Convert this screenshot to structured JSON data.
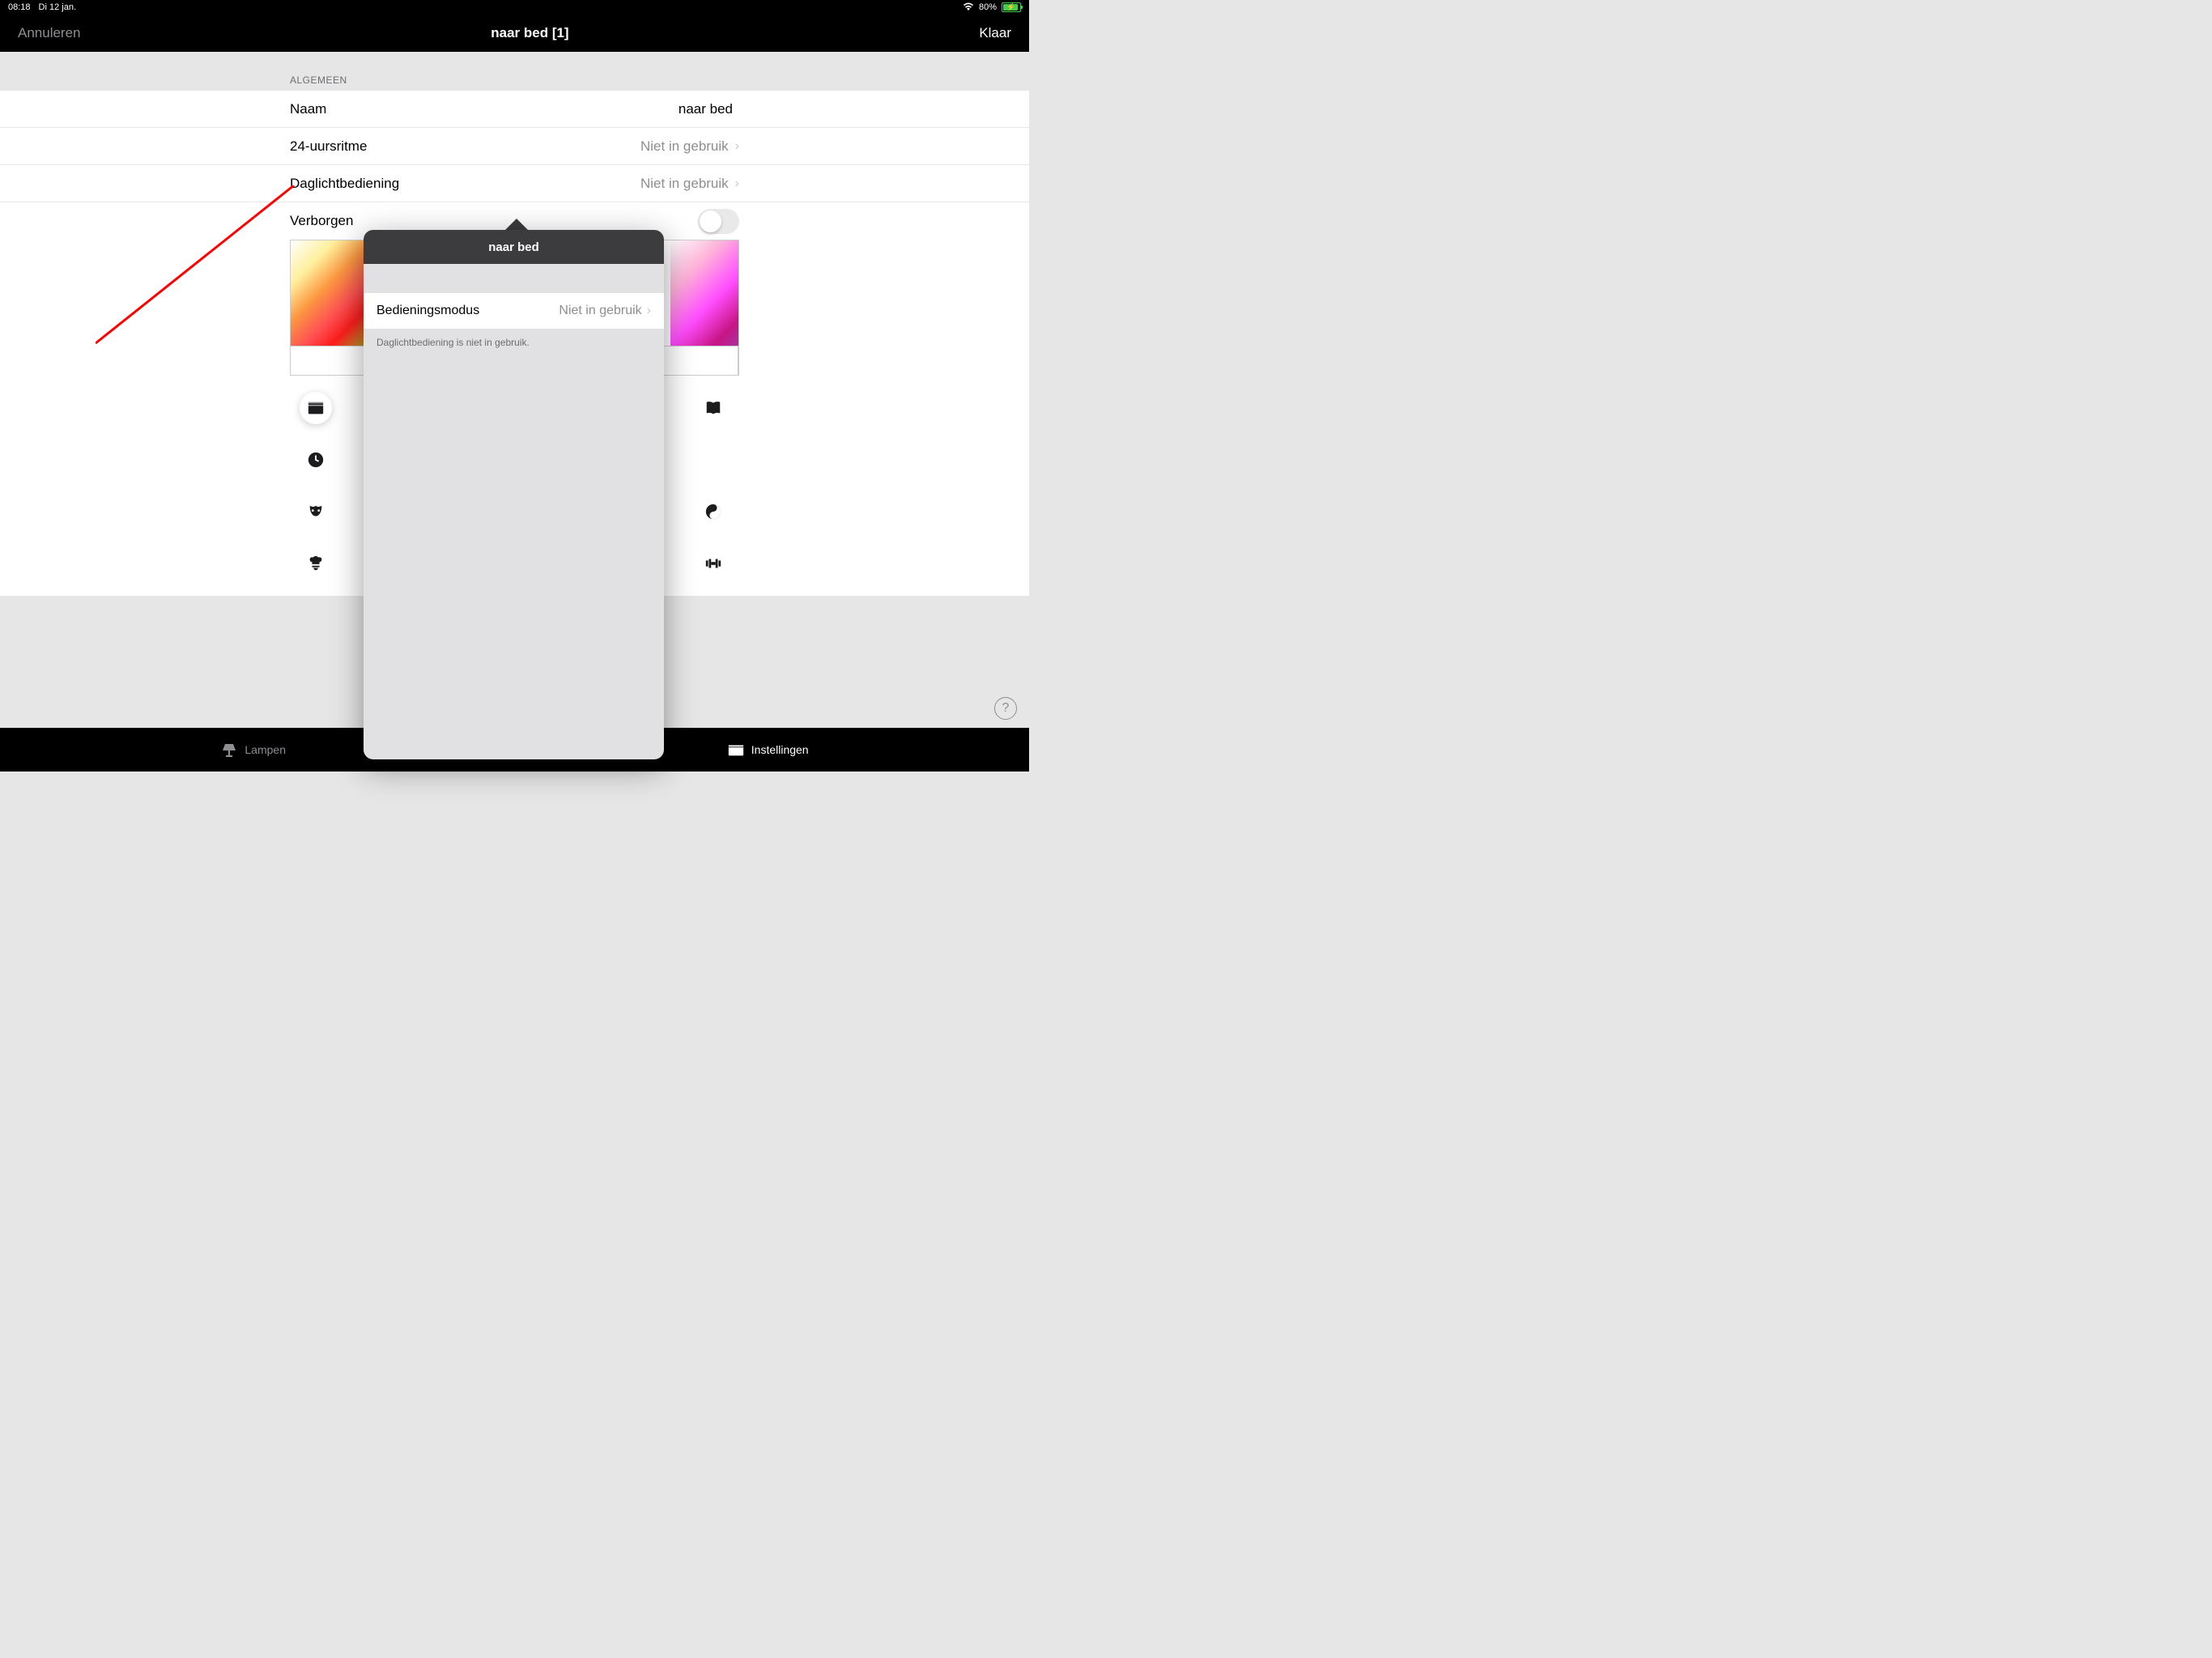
{
  "status": {
    "time": "08:18",
    "date": "Di 12 jan.",
    "battery": "80%"
  },
  "nav": {
    "cancel": "Annuleren",
    "title": "naar bed [1]",
    "done": "Klaar"
  },
  "sections": {
    "general_header": "ALGEMEEN"
  },
  "rows": {
    "name": {
      "label": "Naam",
      "value": "naar bed"
    },
    "rhythm24": {
      "label": "24-uursritme",
      "value": "Niet in gebruik"
    },
    "daylight": {
      "label": "Daglichtbediening",
      "value": "Niet in gebruik"
    },
    "hidden": {
      "label": "Verborgen"
    }
  },
  "popover": {
    "title": "naar bed",
    "mode_label": "Bedieningsmodus",
    "mode_value": "Niet in gebruik",
    "footer": "Daglichtbediening is niet in gebruik."
  },
  "tabs": {
    "lampen": "Lampen",
    "settings": "Instellingen"
  }
}
